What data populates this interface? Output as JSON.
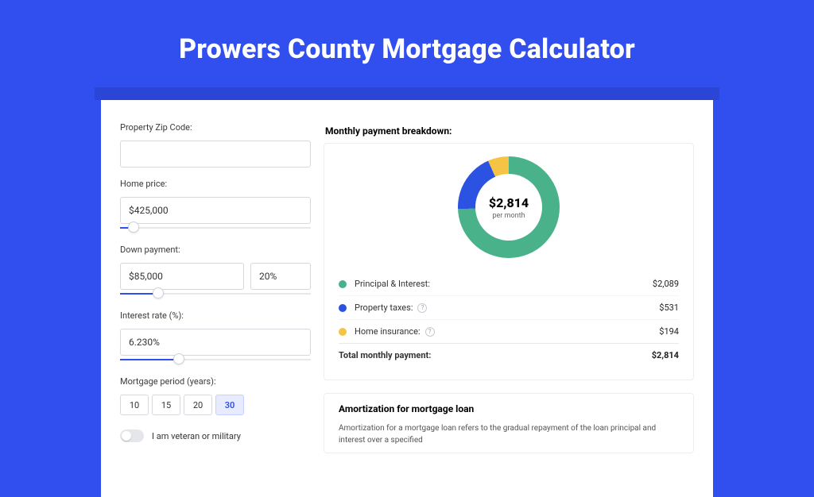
{
  "title": "Prowers County Mortgage Calculator",
  "left": {
    "zip_label": "Property Zip Code:",
    "zip_value": "",
    "price_label": "Home price:",
    "price_value": "$425,000",
    "price_slider_pct": 7,
    "down_label": "Down payment:",
    "down_value": "$85,000",
    "down_pct": "20%",
    "down_slider_pct": 20,
    "rate_label": "Interest rate (%):",
    "rate_value": "6.230%",
    "rate_slider_pct": 31,
    "period_label": "Mortgage period (years):",
    "periods": [
      "10",
      "15",
      "20",
      "30"
    ],
    "period_selected": "30",
    "vet_label": "I am veteran or military"
  },
  "right": {
    "breakdown_title": "Monthly payment breakdown:",
    "donut_amount": "$2,814",
    "donut_sub": "per month",
    "rows": [
      {
        "color": "green",
        "label": "Principal & Interest:",
        "info": false,
        "value": "$2,089"
      },
      {
        "color": "blue",
        "label": "Property taxes:",
        "info": true,
        "value": "$531"
      },
      {
        "color": "yellow",
        "label": "Home insurance:",
        "info": true,
        "value": "$194"
      }
    ],
    "total_label": "Total monthly payment:",
    "total_value": "$2,814",
    "amort_title": "Amortization for mortgage loan",
    "amort_text": "Amortization for a mortgage loan refers to the gradual repayment of the loan principal and interest over a specified"
  },
  "chart_data": {
    "type": "pie",
    "title": "Monthly payment breakdown",
    "series": [
      {
        "name": "Principal & Interest",
        "value": 2089,
        "color": "#49b28a"
      },
      {
        "name": "Property taxes",
        "value": 531,
        "color": "#2b52e0"
      },
      {
        "name": "Home insurance",
        "value": 194,
        "color": "#f5c445"
      }
    ],
    "total": 2814,
    "center_label": "$2,814 per month"
  }
}
